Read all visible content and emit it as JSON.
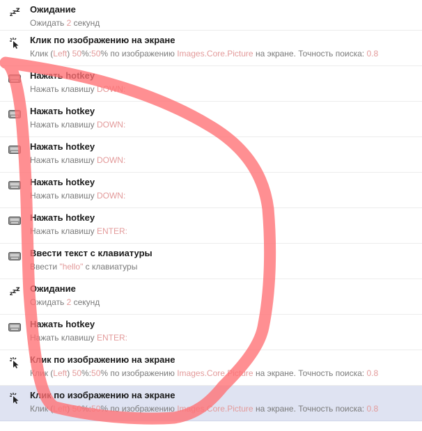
{
  "rows": [
    {
      "icon": "sleep-icon",
      "title": "Ожидание",
      "desc": [
        {
          "t": "Ожидать "
        },
        {
          "t": "2",
          "h": true
        },
        {
          "t": " секунд"
        }
      ]
    },
    {
      "icon": "click-cursor-icon",
      "title": "Клик по изображению на экране",
      "desc": [
        {
          "t": "Клик ("
        },
        {
          "t": "Left",
          "h": true
        },
        {
          "t": ") "
        },
        {
          "t": "50",
          "h": true
        },
        {
          "t": "%:"
        },
        {
          "t": "50",
          "h": true
        },
        {
          "t": "% по изображению "
        },
        {
          "t": "Images.Core.Picture",
          "h": true
        },
        {
          "t": " на экране. Точность поиска: "
        },
        {
          "t": "0.8",
          "h": true
        }
      ]
    },
    {
      "icon": "keyboard-icon",
      "title": "Нажать hotkey",
      "desc": [
        {
          "t": "Нажать клавишу "
        },
        {
          "t": "DOWN:",
          "h": true
        }
      ]
    },
    {
      "icon": "keyboard-icon",
      "title": "Нажать hotkey",
      "desc": [
        {
          "t": "Нажать клавишу "
        },
        {
          "t": "DOWN:",
          "h": true
        }
      ]
    },
    {
      "icon": "keyboard-icon",
      "title": "Нажать hotkey",
      "desc": [
        {
          "t": "Нажать клавишу "
        },
        {
          "t": "DOWN:",
          "h": true
        }
      ]
    },
    {
      "icon": "keyboard-icon",
      "title": "Нажать hotkey",
      "desc": [
        {
          "t": "Нажать клавишу "
        },
        {
          "t": "DOWN:",
          "h": true
        }
      ]
    },
    {
      "icon": "keyboard-icon",
      "title": "Нажать hotkey",
      "desc": [
        {
          "t": "Нажать клавишу "
        },
        {
          "t": "ENTER:",
          "h": true
        }
      ]
    },
    {
      "icon": "keyboard-icon",
      "title": "Ввести текст с клавиатуры",
      "desc": [
        {
          "t": "Ввести "
        },
        {
          "t": "\"hello\"",
          "h": true
        },
        {
          "t": " с клавиатуры"
        }
      ]
    },
    {
      "icon": "sleep-icon",
      "title": "Ожидание",
      "desc": [
        {
          "t": "Ожидать "
        },
        {
          "t": "2",
          "h": true
        },
        {
          "t": " секунд"
        }
      ]
    },
    {
      "icon": "keyboard-icon",
      "title": "Нажать hotkey",
      "desc": [
        {
          "t": "Нажать клавишу "
        },
        {
          "t": "ENTER:",
          "h": true
        }
      ]
    },
    {
      "icon": "click-cursor-icon",
      "title": "Клик по изображению на экране",
      "desc": [
        {
          "t": "Клик ("
        },
        {
          "t": "Left",
          "h": true
        },
        {
          "t": ") "
        },
        {
          "t": "50",
          "h": true
        },
        {
          "t": "%:"
        },
        {
          "t": "50",
          "h": true
        },
        {
          "t": "% по изображению "
        },
        {
          "t": "Images.Core.Picture",
          "h": true
        },
        {
          "t": " на экране. Точность поиска: "
        },
        {
          "t": "0.8",
          "h": true
        }
      ]
    },
    {
      "icon": "click-cursor-icon",
      "title": "Клик по изображению на экране",
      "selected": true,
      "desc": [
        {
          "t": "Клик ("
        },
        {
          "t": "Left",
          "h": true
        },
        {
          "t": ") "
        },
        {
          "t": "50",
          "h": true
        },
        {
          "t": "%:"
        },
        {
          "t": "50",
          "h": true
        },
        {
          "t": "% по изображению "
        },
        {
          "t": "Images.Core.Picture",
          "h": true
        },
        {
          "t": " на экране. Точность поиска: "
        },
        {
          "t": "0.8",
          "h": true
        }
      ]
    }
  ],
  "colors": {
    "highlight": "#e39a9a",
    "annotation_stroke": "#ff6f73",
    "selected_row": "#dfe3f2"
  }
}
